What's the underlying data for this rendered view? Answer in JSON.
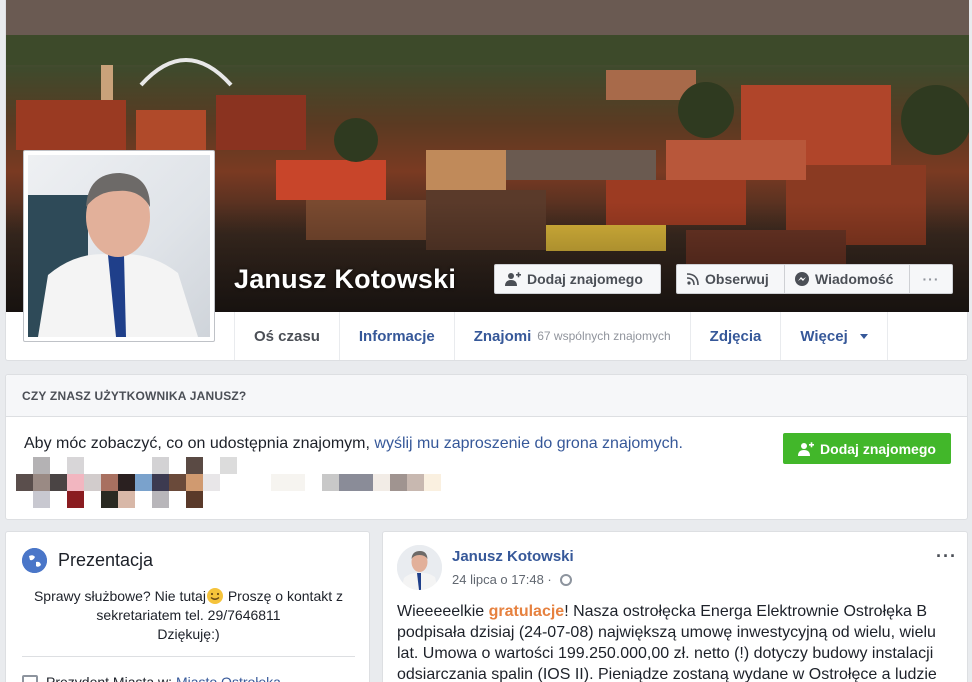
{
  "profile": {
    "name": "Janusz Kotowski",
    "add_friend": "Dodaj znajomego",
    "follow": "Obserwuj",
    "message": "Wiadomość",
    "more": "···"
  },
  "tabs": [
    {
      "label": "Oś czasu",
      "sub": ""
    },
    {
      "label": "Informacje",
      "sub": ""
    },
    {
      "label": "Znajomi",
      "sub": "67 wspólnych znajomych"
    },
    {
      "label": "Zdjęcia",
      "sub": ""
    },
    {
      "label": "Więcej",
      "sub": ""
    }
  ],
  "know": {
    "header": "CZY ZNASZ UŻYTKOWNIKA JANUSZ?",
    "text_prefix": "Aby móc zobaczyć, co on udostępnia znajomym, ",
    "text_link": "wyślij mu zaproszenie do grona znajomych.",
    "button": "Dodaj znajomego"
  },
  "intro": {
    "title": "Prezentacja",
    "desc_line1_before_emoji": "Sprawy służbowe? Nie tutaj",
    "desc_line1_after_emoji": " Proszę o kontakt z",
    "desc_line2": "sekretariatem tel. 29/7646811",
    "desc_line3": "Dziękuję:)",
    "work_prefix": "Prezydent Miasta w: ",
    "work_link": "Miasto Ostrołęka"
  },
  "post": {
    "author": "Janusz Kotowski",
    "date": "24 lipca o 17:48 ·",
    "more": "···",
    "text_start": "Wieeeeelkie ",
    "text_highlight": "gratulacje",
    "text_rest": "! Nasza ostrołęcka Energa Elektrownie Ostrołęka B podpisała dzisiaj (24-07-08) największą umowę inwestycyjną od wielu, wielu lat. Umowa o wartości 199.250.000,00 zł. netto (!) dotyczy budowy instalacji odsiarczania spalin (IOS II). Pieniądze zostaną wydane w Ostrołęce a ludzie"
  },
  "colors": {
    "link": "#365899",
    "green": "#42b72a",
    "highlight": "#e6813f"
  }
}
